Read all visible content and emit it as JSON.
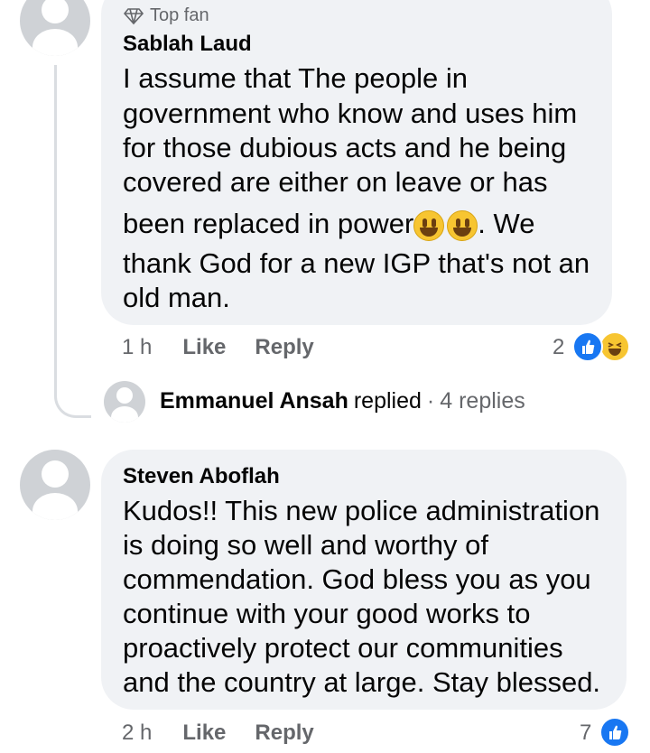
{
  "comment1": {
    "badge": "Top fan",
    "author": "Sablah Laud",
    "lines": [
      "I assume that The people in",
      "government who know and uses him",
      "for those dubious acts and he  being",
      "covered are either on leave or has",
      "been replaced in power",
      ". We",
      "thank God for a new IGP that's not an",
      "old man."
    ],
    "time": "1 h",
    "like": "Like",
    "reply": "Reply",
    "reaction_count": "2"
  },
  "replies_link": {
    "name": "Emmanuel Ansah",
    "replied": "replied",
    "sep": "·",
    "count": "4 replies"
  },
  "comment2": {
    "author": "Steven Aboflah",
    "lines": [
      "Kudos!! This new police administration",
      "is doing so well and worthy of",
      "commendation. God bless you as you",
      "continue with your good works to",
      "proactively protect our communities",
      "and the country at large. Stay blessed."
    ],
    "time": "2 h",
    "like": "Like",
    "reply": "Reply",
    "reaction_count": "7"
  },
  "icons": {
    "avatar": "default-profile-avatar",
    "badge": "diamond-icon",
    "like": "thumbs-up-reaction-icon",
    "haha": "haha-reaction-icon",
    "emoji": "grinning-face-emoji"
  },
  "colors": {
    "bubble": "#f0f2f5",
    "like_blue": "#1877f2",
    "meta_gray": "#65676b"
  }
}
